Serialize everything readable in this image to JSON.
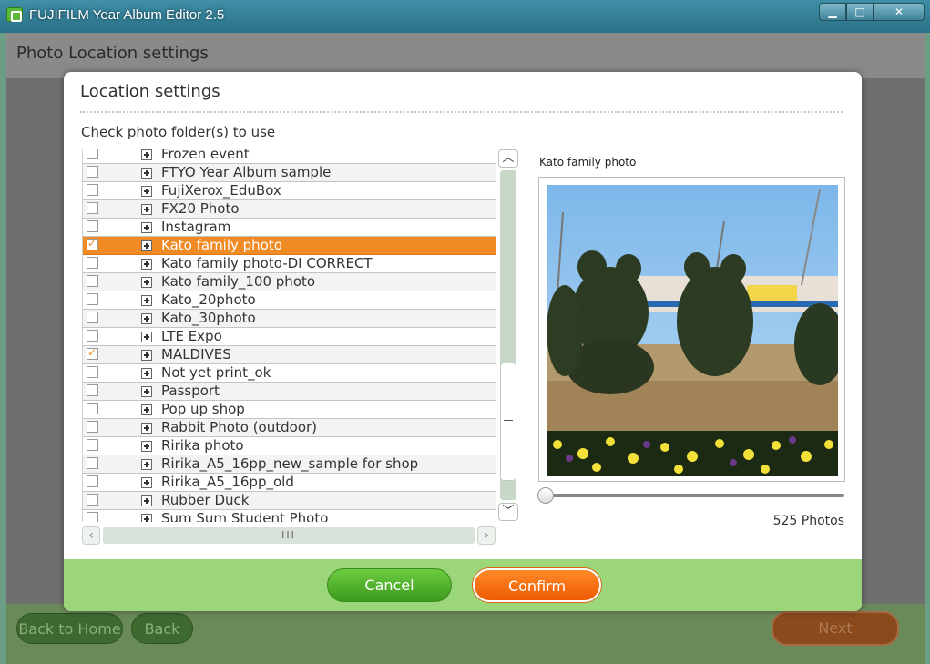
{
  "window": {
    "title": "FUJIFILM Year Album Editor 2.5",
    "min_label": "▁",
    "max_label": "□",
    "close_label": "✕"
  },
  "app": {
    "header_title": "Photo Location settings",
    "back_home_label": "Back to Home",
    "back_label": "Back",
    "next_label": "Next"
  },
  "dialog": {
    "title": "Location settings",
    "subtitle": "Check photo folder(s) to use",
    "folders": [
      {
        "name": "Frozen event",
        "checked": false
      },
      {
        "name": "FTYO Year Album sample",
        "checked": false
      },
      {
        "name": "FujiXerox_EduBox",
        "checked": false
      },
      {
        "name": "FX20 Photo",
        "checked": false
      },
      {
        "name": "Instagram",
        "checked": false
      },
      {
        "name": "Kato family photo",
        "checked": true,
        "selected": true
      },
      {
        "name": "Kato family photo-DI CORRECT",
        "checked": false
      },
      {
        "name": "Kato family_100 photo",
        "checked": false
      },
      {
        "name": "Kato_20photo",
        "checked": false
      },
      {
        "name": "Kato_30photo",
        "checked": false
      },
      {
        "name": "LTE Expo",
        "checked": false
      },
      {
        "name": "MALDIVES",
        "checked": true
      },
      {
        "name": "Not yet print_ok",
        "checked": false
      },
      {
        "name": "Passport",
        "checked": false
      },
      {
        "name": "Pop up shop",
        "checked": false
      },
      {
        "name": "Rabbit Photo (outdoor)",
        "checked": false
      },
      {
        "name": "Ririka photo",
        "checked": false
      },
      {
        "name": "Ririka_A5_16pp_new_sample for shop",
        "checked": false
      },
      {
        "name": "Ririka_A5_16pp_old",
        "checked": false
      },
      {
        "name": "Rubber Duck",
        "checked": false
      },
      {
        "name": "Sum Sum Student Photo",
        "checked": false
      }
    ],
    "scroll_up_label": "︿",
    "scroll_down_label": "﹀",
    "scroll_left_label": "‹",
    "scroll_right_label": "›",
    "hscroll_grip": "III",
    "preview_label": "Kato family photo",
    "photo_count": "525 Photos",
    "cancel_label": "Cancel",
    "confirm_label": "Confirm"
  },
  "colors": {
    "selected_row": "#f08a24",
    "footer_bar": "#9bd67a",
    "cancel_button": "#4caf2a",
    "confirm_button": "#f56a10"
  }
}
